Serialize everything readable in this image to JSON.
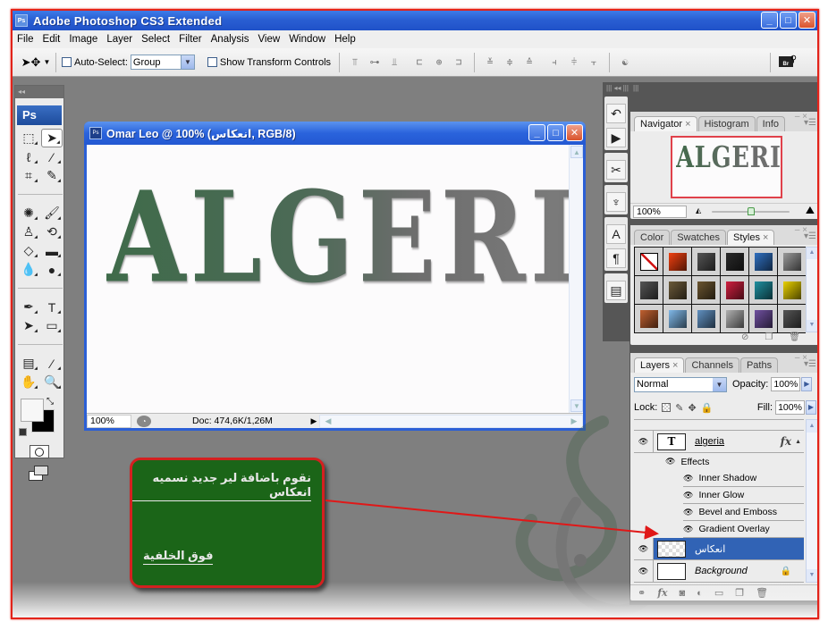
{
  "window": {
    "title": "Adobe Photoshop CS3 Extended",
    "controls": {
      "minimize": "_",
      "maximize": "□",
      "close": "✕"
    }
  },
  "menu": [
    "File",
    "Edit",
    "Image",
    "Layer",
    "Select",
    "Filter",
    "Analysis",
    "View",
    "Window",
    "Help"
  ],
  "options_bar": {
    "tool": "move-tool",
    "auto_select_label": "Auto-Select:",
    "auto_select_checked": false,
    "auto_select_value": "Group",
    "show_transform_label": "Show Transform Controls",
    "show_transform_checked": false,
    "align_icons": [
      "align-top-icon",
      "align-vcenter-icon",
      "align-bottom-icon",
      "align-left-icon",
      "align-hcenter-icon",
      "align-right-icon"
    ],
    "distribute_icons": [
      "dist-top-icon",
      "dist-vcenter-icon",
      "dist-bottom-icon",
      "dist-left-icon",
      "dist-hcenter-icon",
      "dist-right-icon"
    ],
    "auto_align_icon": "auto-align-layers-icon",
    "bridge_label": "Br"
  },
  "toolbox": {
    "logo": "Ps",
    "tools": [
      {
        "name": "marquee-tool",
        "glyph": "⬚"
      },
      {
        "name": "move-tool",
        "glyph": "➤",
        "active": true
      },
      {
        "name": "lasso-tool",
        "glyph": "ℓ"
      },
      {
        "name": "magic-wand-tool",
        "glyph": "⁄"
      },
      {
        "name": "crop-tool",
        "glyph": "⌗"
      },
      {
        "name": "slice-tool",
        "glyph": "✎"
      },
      {
        "sep": true
      },
      {
        "name": "healing-brush-tool",
        "glyph": "✺"
      },
      {
        "name": "brush-tool",
        "glyph": "🖌"
      },
      {
        "name": "clone-stamp-tool",
        "glyph": "♙"
      },
      {
        "name": "history-brush-tool",
        "glyph": "⟲"
      },
      {
        "name": "eraser-tool",
        "glyph": "◇"
      },
      {
        "name": "gradient-tool",
        "glyph": "▬"
      },
      {
        "name": "blur-tool",
        "glyph": "💧"
      },
      {
        "name": "dodge-tool",
        "glyph": "●"
      },
      {
        "sep": true
      },
      {
        "name": "pen-tool",
        "glyph": "✒"
      },
      {
        "name": "type-tool",
        "glyph": "T"
      },
      {
        "name": "path-selection-tool",
        "glyph": "➤"
      },
      {
        "name": "shape-tool",
        "glyph": "▭"
      },
      {
        "sep": true
      },
      {
        "name": "notes-tool",
        "glyph": "▤"
      },
      {
        "name": "eyedropper-tool",
        "glyph": "⁄"
      },
      {
        "name": "hand-tool",
        "glyph": "✋"
      },
      {
        "name": "zoom-tool",
        "glyph": "🔍"
      }
    ],
    "foreground_color": "#f7f7f7",
    "background_color": "#000000"
  },
  "document": {
    "title": "Omar Leo @ 100% (انعكاس, RGB/8)",
    "canvas_text": "ALGERIA",
    "zoom": "100%",
    "doc_info": "Doc: 474,6K/1,26M"
  },
  "dock_icons": [
    "history-icon",
    "actions-icon",
    "tool-presets-icon",
    "brushes-icon",
    "character-icon",
    "paragraph-icon",
    "layer-comps-icon"
  ],
  "navigator": {
    "tabs": [
      {
        "label": "Navigator",
        "active": true,
        "closable": true
      },
      {
        "label": "Histogram",
        "active": false
      },
      {
        "label": "Info",
        "active": false
      }
    ],
    "thumb_text": "ALGERIA",
    "zoom": "100%",
    "zoom_slider_fraction": 0.5
  },
  "styles": {
    "tabs": [
      {
        "label": "Color",
        "active": false
      },
      {
        "label": "Swatches",
        "active": false
      },
      {
        "label": "Styles",
        "active": true,
        "closable": true
      }
    ],
    "swatches": [
      "none",
      "#f04010",
      "#555555",
      "#2a2a2a",
      "#3070c0",
      "#9a9a9a",
      "#555555",
      "#6b5a3a",
      "#6b5530",
      "#d02040",
      "#2090a0",
      "#e8d000",
      "#c06030",
      "#80b8e8",
      "#6090c0",
      "#b0b0b0",
      "#7050a0",
      "#555555"
    ],
    "footer_icons": [
      "clear-style-icon",
      "new-style-icon",
      "delete-style-icon"
    ]
  },
  "layers": {
    "tabs": [
      {
        "label": "Layers",
        "active": true,
        "closable": true
      },
      {
        "label": "Channels",
        "active": false
      },
      {
        "label": "Paths",
        "active": false
      }
    ],
    "blend_mode": "Normal",
    "opacity_label": "Opacity:",
    "opacity": "100%",
    "lock_label": "Lock:",
    "fill_label": "Fill:",
    "fill": "100%",
    "items": [
      {
        "name": "algeria",
        "type": "text",
        "thumb": "T",
        "fx": "fx",
        "visible": true
      },
      {
        "name": "انعكاس",
        "type": "empty",
        "selected": true,
        "visible": true
      },
      {
        "name": "Background",
        "type": "background",
        "locked": true,
        "visible": true
      }
    ],
    "effects_label": "Effects",
    "effects": [
      "Inner Shadow",
      "Inner Glow",
      "Bevel and Emboss",
      "Gradient Overlay"
    ],
    "footer_icons": [
      "link-layers-icon",
      "fx-icon",
      "add-mask-icon",
      "adjustment-layer-icon",
      "new-group-icon",
      "new-layer-icon",
      "delete-layer-icon"
    ]
  },
  "annotation": {
    "line1": "نقوم باضافة لير جديد نسميه انعكاس",
    "line2": "فوق الخلفية",
    "accent_color": "#d42020",
    "box_color": "#1b6518"
  }
}
